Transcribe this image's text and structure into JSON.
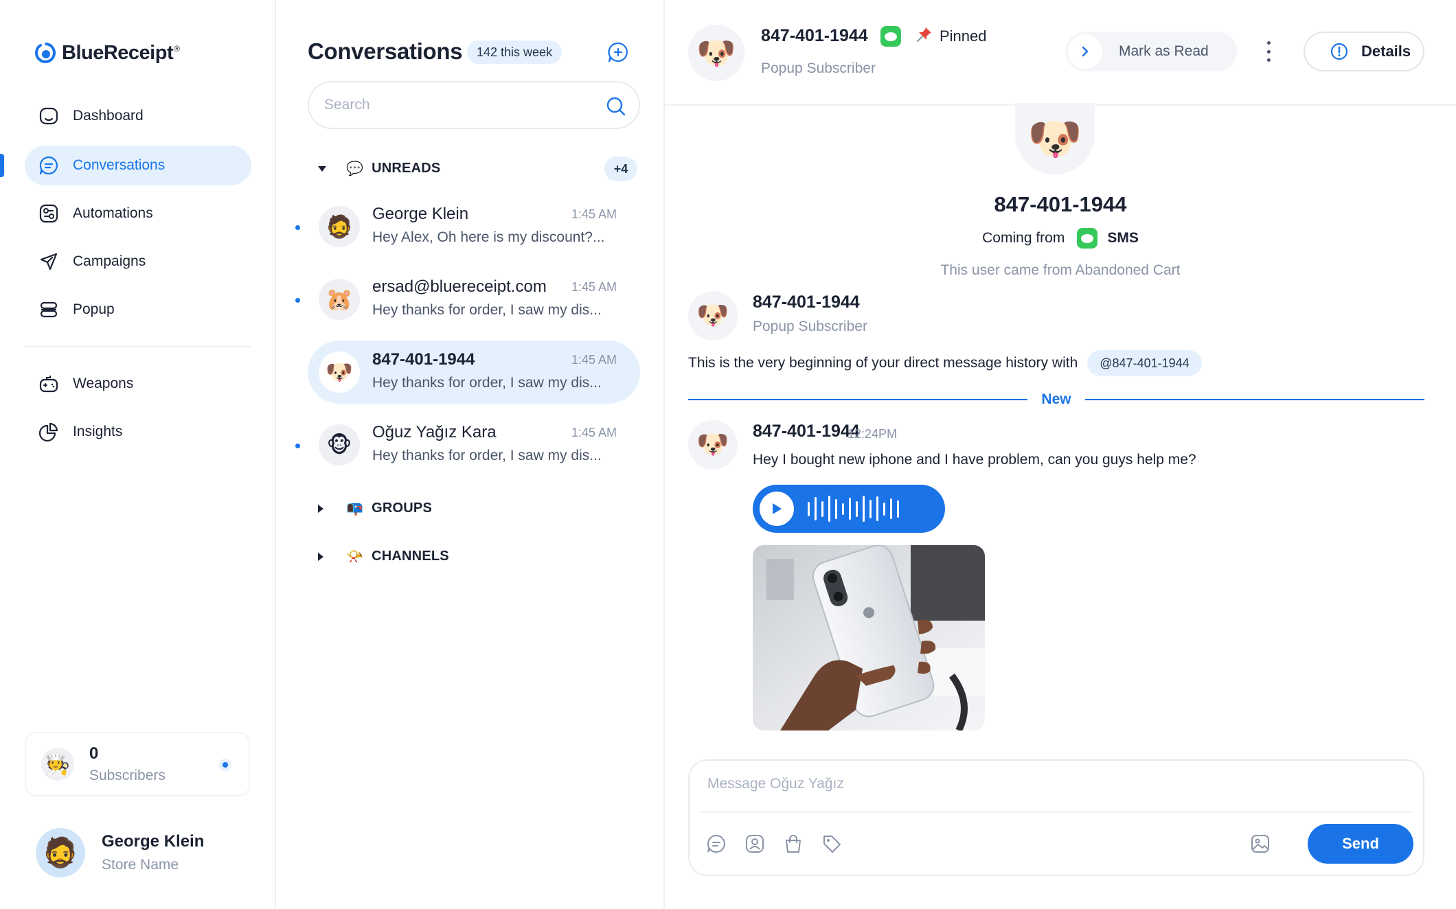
{
  "app": {
    "name": "BlueReceipt",
    "trademark": "®",
    "brand_color": "#1a74e8"
  },
  "sidebar": {
    "nav": [
      {
        "label": "Dashboard",
        "icon": "dashboard-icon",
        "active": false
      },
      {
        "label": "Conversations",
        "icon": "chat-bubble-icon",
        "active": true
      },
      {
        "label": "Automations",
        "icon": "automation-icon",
        "active": false
      },
      {
        "label": "Campaigns",
        "icon": "paper-plane-icon",
        "active": false
      },
      {
        "label": "Popup",
        "icon": "popup-icon",
        "active": false
      }
    ],
    "nav_secondary": [
      {
        "label": "Weapons",
        "icon": "gamepad-icon",
        "active": false
      },
      {
        "label": "Insights",
        "icon": "pie-chart-icon",
        "active": false
      }
    ],
    "subscribers": {
      "count": "0",
      "label": "Subscribers",
      "avatar": "🧑‍🍳"
    },
    "user": {
      "name": "George Klein",
      "store": "Store Name",
      "avatar": "🧔"
    }
  },
  "conversations": {
    "title": "Conversations",
    "week_badge": "142 this week",
    "search_placeholder": "Search",
    "sections": {
      "unreads": {
        "label": "UNREADS",
        "emoji": "💬",
        "badge": "+4",
        "expanded": true
      },
      "groups": {
        "label": "GROUPS",
        "emoji": "📭",
        "expanded": false
      },
      "channels": {
        "label": "CHANNELS",
        "emoji": "📯",
        "expanded": false
      }
    },
    "items": [
      {
        "name": "George Klein",
        "time": "1:45 AM",
        "preview": "Hey Alex, Oh here is my discount?...",
        "avatar": "🧔",
        "unread": true,
        "selected": false
      },
      {
        "name": "ersad@bluereceipt.com",
        "time": "1:45 AM",
        "preview": "Hey thanks for order, I saw my dis...",
        "avatar": "🐹",
        "unread": true,
        "selected": false
      },
      {
        "name": "847-401-1944",
        "time": "1:45 AM",
        "preview": "Hey thanks for order, I saw my dis...",
        "avatar": "🐶",
        "unread": false,
        "selected": true
      },
      {
        "name": "Oğuz Yağız Kara",
        "time": "1:45 AM",
        "preview": "Hey thanks for order, I saw my dis...",
        "avatar": "🐵",
        "unread": true,
        "selected": false
      }
    ]
  },
  "chat": {
    "header": {
      "name": "847-401-1944",
      "subtitle": "Popup Subscriber",
      "pinned_label": "Pinned",
      "mark_read_label": "Mark as Read",
      "details_label": "Details",
      "avatar": "🐶"
    },
    "intro": {
      "name": "847-401-1944",
      "coming_from_label": "Coming from",
      "channel": "SMS",
      "note": "This user came from Abandoned Cart",
      "avatar": "🐶"
    },
    "first_message": {
      "name": "847-401-1944",
      "subtitle": "Popup Subscriber",
      "history_text": "This is the very beginning of your direct message history with",
      "mention": "@847-401-1944"
    },
    "new_divider": "New",
    "message": {
      "name": "847-401-1944",
      "time": "12:24PM",
      "text": "Hey I bought new iphone and I have problem, can you guys help me?",
      "audio_wave": [
        0.55,
        0.9,
        0.6,
        1.0,
        0.75,
        0.45,
        0.85,
        0.6,
        1.0,
        0.7,
        0.95,
        0.5,
        0.8,
        0.65
      ],
      "attachment": "photo"
    },
    "composer": {
      "placeholder": "Message Oğuz Yağız",
      "send_label": "Send",
      "tools": [
        "chat-bubble-icon",
        "contact-card-icon",
        "shopping-bag-icon",
        "tag-icon"
      ],
      "image_tool": "image-icon"
    }
  }
}
